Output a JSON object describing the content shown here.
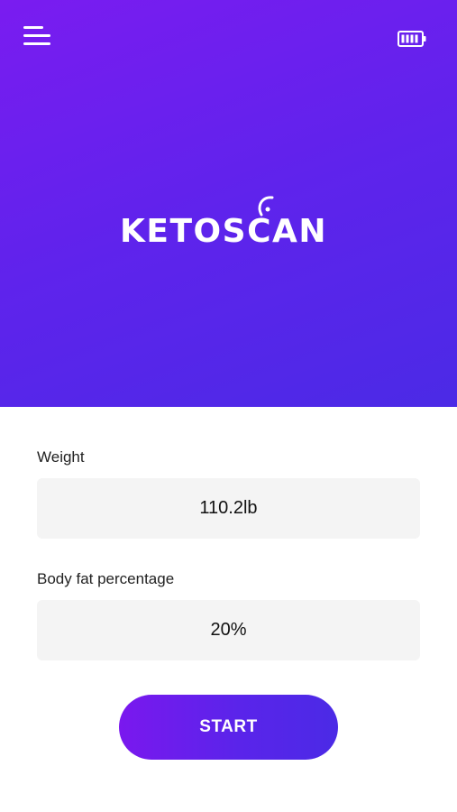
{
  "header": {
    "menu_icon": "hamburger-menu-icon",
    "battery_icon": "battery-full-icon",
    "logo_text": "KETOSCAN",
    "logo_mark_icon": "breath-sensor-icon"
  },
  "form": {
    "weight": {
      "label": "Weight",
      "value": "110.2lb"
    },
    "body_fat": {
      "label": "Body fat percentage",
      "value": "20%"
    },
    "start_label": "START"
  },
  "colors": {
    "gradient_start": "#7a1cf0",
    "gradient_end": "#4b2ae6",
    "field_background": "#f4f4f4"
  }
}
